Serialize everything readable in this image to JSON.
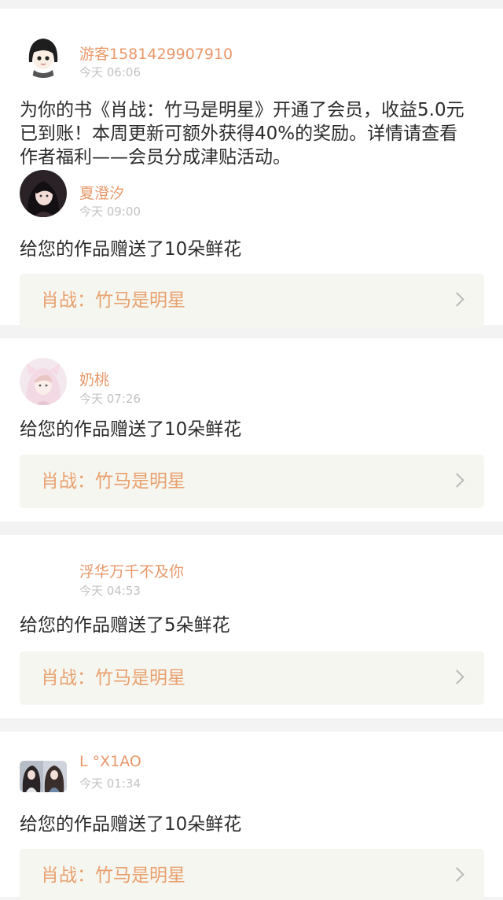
{
  "notifications": [
    {
      "username": "游客1581429907910",
      "time": "今天 06:06",
      "avatar_icon": "cartoon-girl-avatar-icon",
      "message": "为你的书《肖战：竹马是明星》开通了会员，收益5.0元已到账！本周更新可额外获得40%的奖励。详情请查看作者福利——会员分成津贴活动。"
    },
    {
      "username": "夏澄汐",
      "time": "今天 09:00",
      "avatar_icon": "girl-photo-avatar-icon",
      "message": "给您的作品赠送了10朵鲜花",
      "book_title": "肖战：竹马是明星"
    },
    {
      "username": "奶桃",
      "time": "今天 07:26",
      "avatar_icon": "girl-hood-avatar-icon",
      "message": "给您的作品赠送了10朵鲜花",
      "book_title": "肖战：竹马是明星"
    },
    {
      "username": "浮华万千不及你",
      "time": "今天 04:53",
      "avatar_icon": "blank-avatar-icon",
      "message": "给您的作品赠送了5朵鲜花",
      "book_title": "肖战：竹马是明星"
    },
    {
      "username": "L °X1AO",
      "time": "今天 01:34",
      "avatar_icon": "two-girls-avatar-icon",
      "message": "给您的作品赠送了10朵鲜花",
      "book_title": "肖战：竹马是明星"
    }
  ],
  "colors": {
    "username": "#e8986a",
    "book_title": "#e8a06e",
    "time": "#c3c3c3",
    "message": "#2b2b2b",
    "book_bg": "#f6f6f0",
    "separator": "#f3f3f3"
  }
}
